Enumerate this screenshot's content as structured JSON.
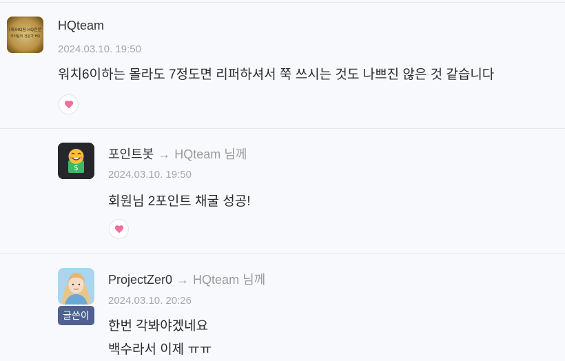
{
  "comments": [
    {
      "author": "HQteam",
      "date": "2024.03.10. 19:50",
      "lines": [
        "워치6이하는 몰라도 7정도면 리퍼하셔서 쭉 쓰시는 것도 나쁘진 않은 것 같습니다"
      ],
      "avatar_icon": "hq-team-logo",
      "avatar_logo_lines": [
        "(재)HQ팀 HQ전문",
        "우리팀의 전문가 HQ"
      ]
    },
    {
      "author": "포인트봇",
      "reply_arrow": "→",
      "reply_to": "HQteam",
      "reply_suffix": "님께",
      "date": "2024.03.10. 19:50",
      "lines": [
        "회원님 2포인트 채굴 성공!"
      ],
      "avatar_icon": "point-bot-smiley-money-icon"
    },
    {
      "author": "ProjectZer0",
      "reply_arrow": "→",
      "reply_to": "HQteam",
      "reply_suffix": "님께",
      "date": "2024.03.10. 20:26",
      "lines": [
        "한번 각봐야겠네요",
        "백수라서 이제 ㅠㅠ"
      ],
      "badge": "글쓴이",
      "avatar_icon": "user-photo-avatar"
    }
  ],
  "like_icon": "heart-icon",
  "colors": {
    "heart": "#ee6f9a",
    "badge": "#4e6190",
    "background": "#f8f9fd"
  }
}
